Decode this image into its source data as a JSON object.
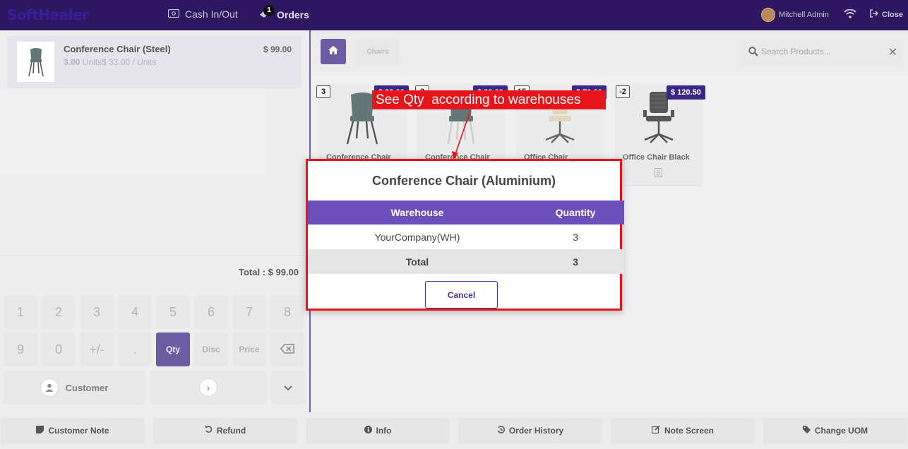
{
  "header": {
    "logo": "SoftHealer",
    "cash_label": "Cash In/Out",
    "orders_label": "Orders",
    "orders_badge": "1",
    "user_name": "Mitchell Admin",
    "close_label": "Close"
  },
  "order": {
    "line": {
      "name": "Conference Chair (Steel)",
      "qty": "3.00",
      "detail": " Units$ 33.00 / Units",
      "price": "$ 99.00"
    },
    "total": "Total : $ 99.00"
  },
  "numpad": {
    "row1": [
      "1",
      "2",
      "3",
      "4",
      "5",
      "6",
      "7",
      "8"
    ],
    "row2": [
      "9",
      "0",
      "+/-",
      "."
    ],
    "qty": "Qty",
    "disc": "Disc",
    "price": "Price",
    "customer": "Customer"
  },
  "products": {
    "breadcrumb": "Chairs",
    "search_placeholder": "Search Products...",
    "items": [
      {
        "name": "Conference Chair",
        "qty": "3",
        "price": "$ 33.00"
      },
      {
        "name": "Conference Chair",
        "qty": "3",
        "price": "$ 33.00"
      },
      {
        "name": "Office Chair",
        "qty": "15",
        "price": "$ 70.00"
      },
      {
        "name": "Office Chair Black",
        "qty": "-2",
        "price": "$ 120.50"
      }
    ]
  },
  "dialog": {
    "title": "Conference Chair (Aluminium)",
    "col_warehouse": "Warehouse",
    "col_quantity": "Quantity",
    "rows": [
      {
        "warehouse": "YourCompany(WH)",
        "quantity": "3"
      }
    ],
    "total_label": "Total",
    "total_value": "3",
    "cancel": "Cancel"
  },
  "annotation": "See Qty  according to warehouses",
  "footer": {
    "customer_note": "Customer Note",
    "refund": "Refund",
    "info": "Info",
    "order_history": "Order History",
    "note_screen": "Note Screen",
    "change_uom": "Change UOM"
  },
  "colors": {
    "brand": "#3b2683",
    "header": "#2d1760",
    "annotation": "#e8141c"
  }
}
